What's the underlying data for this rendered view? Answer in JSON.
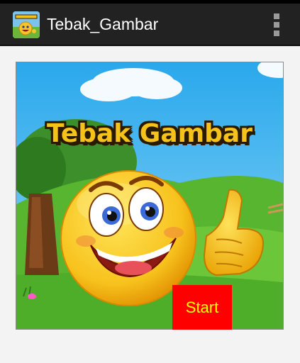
{
  "app": {
    "title": "Tebak_Gambar",
    "icon": "smiley-app-icon",
    "menu_icon": "overflow-menu-icon"
  },
  "banner": {
    "title": "Tebak Gambar",
    "illustration": "smiley-face-thumbs-up"
  },
  "actions": {
    "start_label": "Start"
  },
  "colors": {
    "action_bar": "#222222",
    "start_button_bg": "#ff0000",
    "start_button_text": "#ffff00",
    "title_fill": "#f4c21a"
  }
}
